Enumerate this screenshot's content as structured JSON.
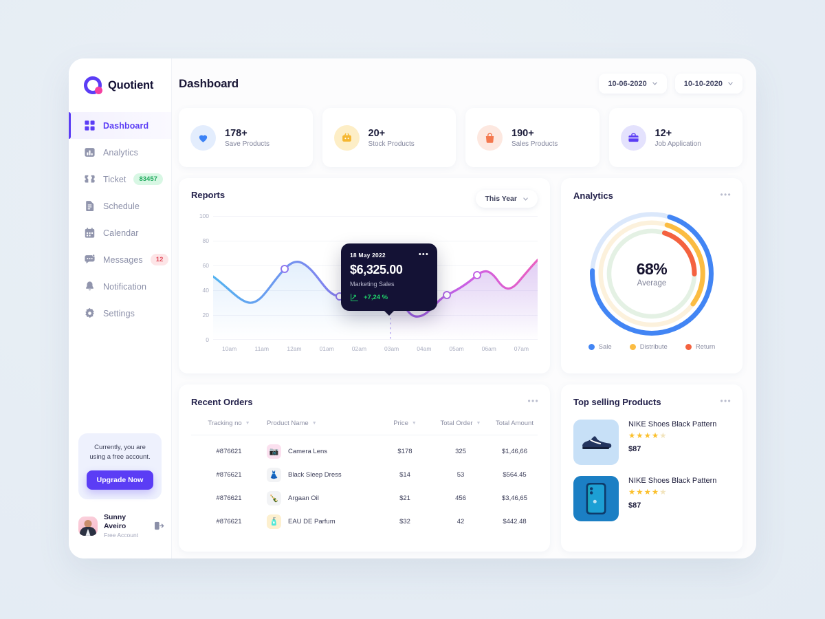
{
  "brand": {
    "name": "Quotient"
  },
  "sidebar": {
    "items": [
      {
        "label": "Dashboard",
        "icon": "grid-icon",
        "active": true
      },
      {
        "label": "Analytics",
        "icon": "bar-chart-icon",
        "active": false
      },
      {
        "label": "Ticket",
        "icon": "ticket-icon",
        "active": false,
        "badge": "83457",
        "badge_color": "green"
      },
      {
        "label": "Schedule",
        "icon": "document-icon",
        "active": false
      },
      {
        "label": "Calendar",
        "icon": "calendar-icon",
        "active": false
      },
      {
        "label": "Messages",
        "icon": "chat-icon",
        "active": false,
        "badge": "12",
        "badge_color": "red"
      },
      {
        "label": "Notification",
        "icon": "bell-icon",
        "active": false
      },
      {
        "label": "Settings",
        "icon": "gear-icon",
        "active": false
      }
    ],
    "upgrade": {
      "text": "Currently, you are using a free account.",
      "button_label": "Upgrade Now"
    },
    "user": {
      "name": "Sunny Aveiro",
      "plan": "Free Account"
    }
  },
  "header": {
    "title": "Dashboard",
    "date_from": "10-06-2020",
    "date_to": "10-10-2020"
  },
  "stats": [
    {
      "value": "178+",
      "label": "Save Products",
      "icon": "heart-icon",
      "bg": "#e3edfd",
      "fg": "#3b82f6"
    },
    {
      "value": "20+",
      "label": "Stock Products",
      "icon": "box-icon",
      "bg": "#fdeec6",
      "fg": "#f5b731"
    },
    {
      "value": "190+",
      "label": "Sales Products",
      "icon": "bag-icon",
      "bg": "#fde8e0",
      "fg": "#f4784e"
    },
    {
      "value": "12+",
      "label": "Job Application",
      "icon": "briefcase-icon",
      "bg": "#e4e2fd",
      "fg": "#5b3df5"
    }
  ],
  "reports": {
    "title": "Reports",
    "range_label": "This Year",
    "tooltip": {
      "date": "18 May 2022",
      "amount": "$6,325.00",
      "subtitle": "Marketing Sales",
      "delta": "+7,24 %"
    }
  },
  "analytics": {
    "title": "Analytics",
    "percent": "68%",
    "label": "Average",
    "legend": [
      {
        "label": "Sale",
        "color": "#4285f4"
      },
      {
        "label": "Distribute",
        "color": "#fbbc42"
      },
      {
        "label": "Return",
        "color": "#f4623f"
      }
    ]
  },
  "orders": {
    "title": "Recent Orders",
    "columns": [
      "Tracking no",
      "Product Name",
      "Price",
      "Total Order",
      "Total Amount"
    ],
    "rows": [
      {
        "tracking": "#876621",
        "product": "Camera Lens",
        "icon": "camera-icon",
        "thumb_bg": "#fbe0ef",
        "price": "$178",
        "total_order": "325",
        "total_amount": "$1,46,66"
      },
      {
        "tracking": "#876621",
        "product": "Black Sleep Dress",
        "icon": "dress-icon",
        "thumb_bg": "#f2f3f5",
        "price": "$14",
        "total_order": "53",
        "total_amount": "$564.45"
      },
      {
        "tracking": "#876621",
        "product": "Argaan Oil",
        "icon": "bottle-icon",
        "thumb_bg": "#f2f3f5",
        "price": "$21",
        "total_order": "456",
        "total_amount": "$3,46,65"
      },
      {
        "tracking": "#876621",
        "product": "EAU DE Parfum",
        "icon": "perfume-icon",
        "thumb_bg": "#fdf0cf",
        "price": "$32",
        "total_order": "42",
        "total_amount": "$442.48"
      }
    ]
  },
  "top_selling": {
    "title": "Top selling Products",
    "products": [
      {
        "name": "NIKE Shoes Black Pattern",
        "rating": 4,
        "max_rating": 5,
        "price": "$87",
        "icon": "shoe-icon",
        "thumb_bg": "#c7e0f7"
      },
      {
        "name": "NIKE Shoes Black Pattern",
        "rating": 4,
        "max_rating": 5,
        "price": "$87",
        "icon": "phone-icon",
        "thumb_bg": "#1b7fc4"
      }
    ]
  },
  "chart_data": {
    "type": "area",
    "title": "Reports",
    "xlabel": "",
    "ylabel": "",
    "categories": [
      "10am",
      "11am",
      "12am",
      "01am",
      "02am",
      "03am",
      "04am",
      "05am",
      "06am",
      "07am"
    ],
    "x": [
      0,
      1,
      2,
      3,
      4,
      5,
      6,
      7,
      8,
      9
    ],
    "series": [
      {
        "name": "Marketing Sales",
        "values": [
          51,
          31,
          57,
          35,
          22,
          50,
          12,
          32,
          56,
          47
        ]
      }
    ],
    "highlight": {
      "x": "02:30am",
      "y": 50,
      "date": "18 May 2022",
      "amount": 6325.0,
      "delta_pct": 7.24
    },
    "markers": [
      {
        "x": 2,
        "y": 57
      },
      {
        "x": 3,
        "y": 35
      },
      {
        "x": 4.5,
        "y": 50
      },
      {
        "x": 7,
        "y": 32
      },
      {
        "x": 8,
        "y": 56
      }
    ],
    "ylim": [
      0,
      100
    ],
    "yticks": [
      0,
      20,
      40,
      60,
      80,
      100
    ],
    "grid": true,
    "legend": "none",
    "gradient_line": [
      "#54b3f0",
      "#8b6ef0",
      "#d95fe0",
      "#e95fc0"
    ]
  },
  "donut_data": {
    "type": "pie",
    "title": "Analytics",
    "center_value": "68%",
    "center_label": "Average",
    "rings": [
      {
        "name": "Sale",
        "value": 72,
        "color": "#4285f4",
        "track": "#d9e6fb"
      },
      {
        "name": "Distribute",
        "value": 30,
        "color": "#fbbc42",
        "track": "#fcf2de"
      },
      {
        "name": "Return",
        "value": 20,
        "color": "#f4623f",
        "track": "#e4f0e3"
      }
    ]
  }
}
